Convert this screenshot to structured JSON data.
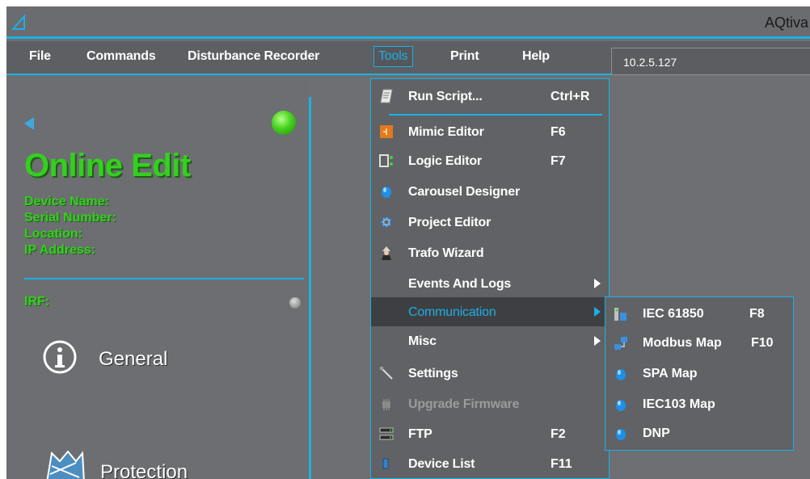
{
  "window": {
    "title": "AQtiva"
  },
  "menubar": {
    "file": "File",
    "commands": "Commands",
    "disturbance_recorder": "Disturbance Recorder",
    "tools": "Tools",
    "print": "Print",
    "help": "Help",
    "ip_address": "10.2.5.127"
  },
  "device_panel": {
    "mode": "Online Edit",
    "device_name_label": "Device Name:",
    "serial_number_label": "Serial Number:",
    "location_label": "Location:",
    "ip_address_label": "IP Address:",
    "irf_label": "IRF:",
    "nav_general": "General",
    "nav_protection": "Protection"
  },
  "tools_menu": {
    "items": [
      {
        "label": "Run Script...",
        "shortcut": "Ctrl+R",
        "icon": "script-icon"
      },
      {
        "label": "Mimic Editor",
        "shortcut": "F6",
        "icon": "mimic-editor-icon"
      },
      {
        "label": "Logic Editor",
        "shortcut": "F7",
        "icon": "logic-editor-icon"
      },
      {
        "label": "Carousel Designer",
        "shortcut": "",
        "icon": "blue-drop-icon"
      },
      {
        "label": "Project Editor",
        "shortcut": "",
        "icon": "gear-icon"
      },
      {
        "label": "Trafo Wizard",
        "shortcut": "",
        "icon": "wizard-icon"
      },
      {
        "label": "Events And Logs",
        "shortcut": "",
        "icon": ""
      },
      {
        "label": "Communication",
        "shortcut": "",
        "icon": ""
      },
      {
        "label": "Misc",
        "shortcut": "",
        "icon": ""
      },
      {
        "label": "Settings",
        "shortcut": "",
        "icon": "wrench-icon"
      },
      {
        "label": "Upgrade Firmware",
        "shortcut": "",
        "icon": "firmware-icon"
      },
      {
        "label": "FTP",
        "shortcut": "F2",
        "icon": "ftp-icon"
      },
      {
        "label": "Device List",
        "shortcut": "F11",
        "icon": "device-list-icon"
      }
    ]
  },
  "communication_submenu": {
    "items": [
      {
        "label": "IEC 61850",
        "shortcut": "F8",
        "icon": "iec61850-icon"
      },
      {
        "label": "Modbus Map",
        "shortcut": "F10",
        "icon": "modbus-icon"
      },
      {
        "label": "SPA Map",
        "shortcut": "",
        "icon": "blue-drop-icon"
      },
      {
        "label": "IEC103 Map",
        "shortcut": "",
        "icon": "blue-drop-icon"
      },
      {
        "label": "DNP",
        "shortcut": "",
        "icon": "blue-drop-icon"
      }
    ]
  },
  "colors": {
    "accent": "#1bb0e6",
    "online_green": "#35cf20",
    "background": "#6d6f72"
  }
}
